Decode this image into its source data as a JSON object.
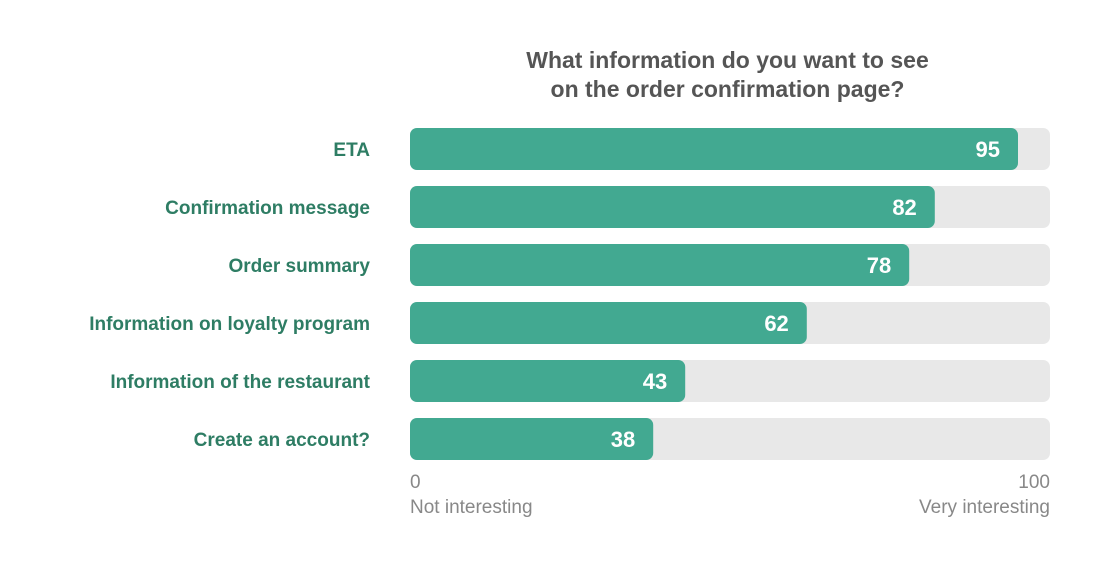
{
  "chart_data": {
    "type": "bar",
    "orientation": "horizontal",
    "title_lines": [
      "What information do you want to see",
      "on the order confirmation page?"
    ],
    "categories": [
      "ETA",
      "Confirmation message",
      "Order summary",
      "Information on loyalty program",
      "Information of the restaurant",
      "Create an account?"
    ],
    "values": [
      95,
      82,
      78,
      62,
      43,
      38
    ],
    "xlim": [
      0,
      100
    ],
    "x_tick_labels": [
      "0",
      "100"
    ],
    "x_end_labels": [
      "Not interesting",
      "Very interesting"
    ],
    "grid": false,
    "data_labels": true,
    "colors": {
      "bar": "#42a991",
      "track": "#e8e8e8",
      "category_label": "#2e7d64",
      "value_label": "#ffffff",
      "axis_text": "#888888",
      "title": "#555555"
    }
  }
}
